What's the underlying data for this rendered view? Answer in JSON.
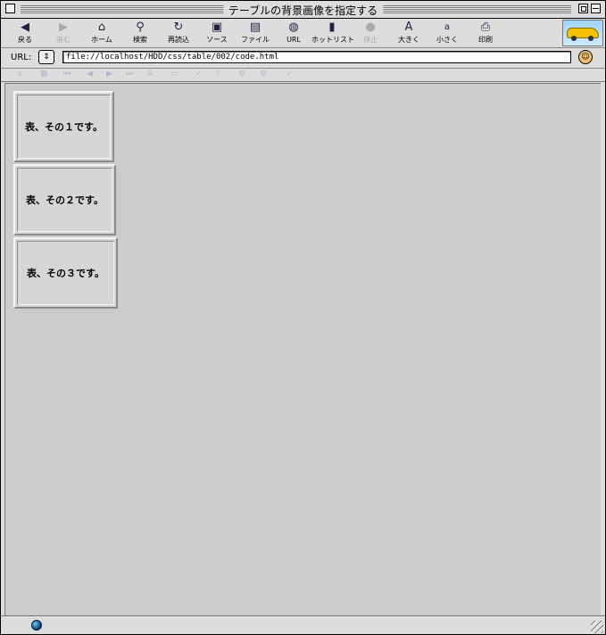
{
  "window": {
    "title": "テーブルの背景画像を指定する"
  },
  "toolbar": {
    "items": [
      {
        "label": "戻る",
        "icon": "back-arrow-icon",
        "enabled": true
      },
      {
        "label": "進む",
        "icon": "forward-arrow-icon",
        "enabled": false
      },
      {
        "label": "ホーム",
        "icon": "home-icon",
        "enabled": true
      },
      {
        "label": "検索",
        "icon": "magnifier-icon",
        "enabled": true
      },
      {
        "label": "再読込",
        "icon": "reload-icon",
        "enabled": true
      },
      {
        "label": "ソース",
        "icon": "source-icon",
        "enabled": true
      },
      {
        "label": "ファイル",
        "icon": "file-icon",
        "enabled": true
      },
      {
        "label": "URL",
        "icon": "globe-icon",
        "enabled": true
      },
      {
        "label": "ホットリスト",
        "icon": "hotlist-icon",
        "enabled": true
      },
      {
        "label": "停止",
        "icon": "stop-icon",
        "enabled": false
      },
      {
        "label": "大きく",
        "icon": "larger-text-icon",
        "enabled": true
      },
      {
        "label": "小さく",
        "icon": "smaller-text-icon",
        "enabled": true
      },
      {
        "label": "印刷",
        "icon": "print-icon",
        "enabled": true
      }
    ]
  },
  "urlbar": {
    "label": "URL:",
    "value": "file://localhost/HDD/css/table/002/code.html"
  },
  "content": {
    "tables": [
      {
        "text": "表、その１です。"
      },
      {
        "text": "表、その２です。"
      },
      {
        "text": "表、その３です。"
      }
    ]
  },
  "colors": {
    "chrome": "#dddddd",
    "content_background": "#cccccc",
    "table_background": "#d6d6d6"
  }
}
